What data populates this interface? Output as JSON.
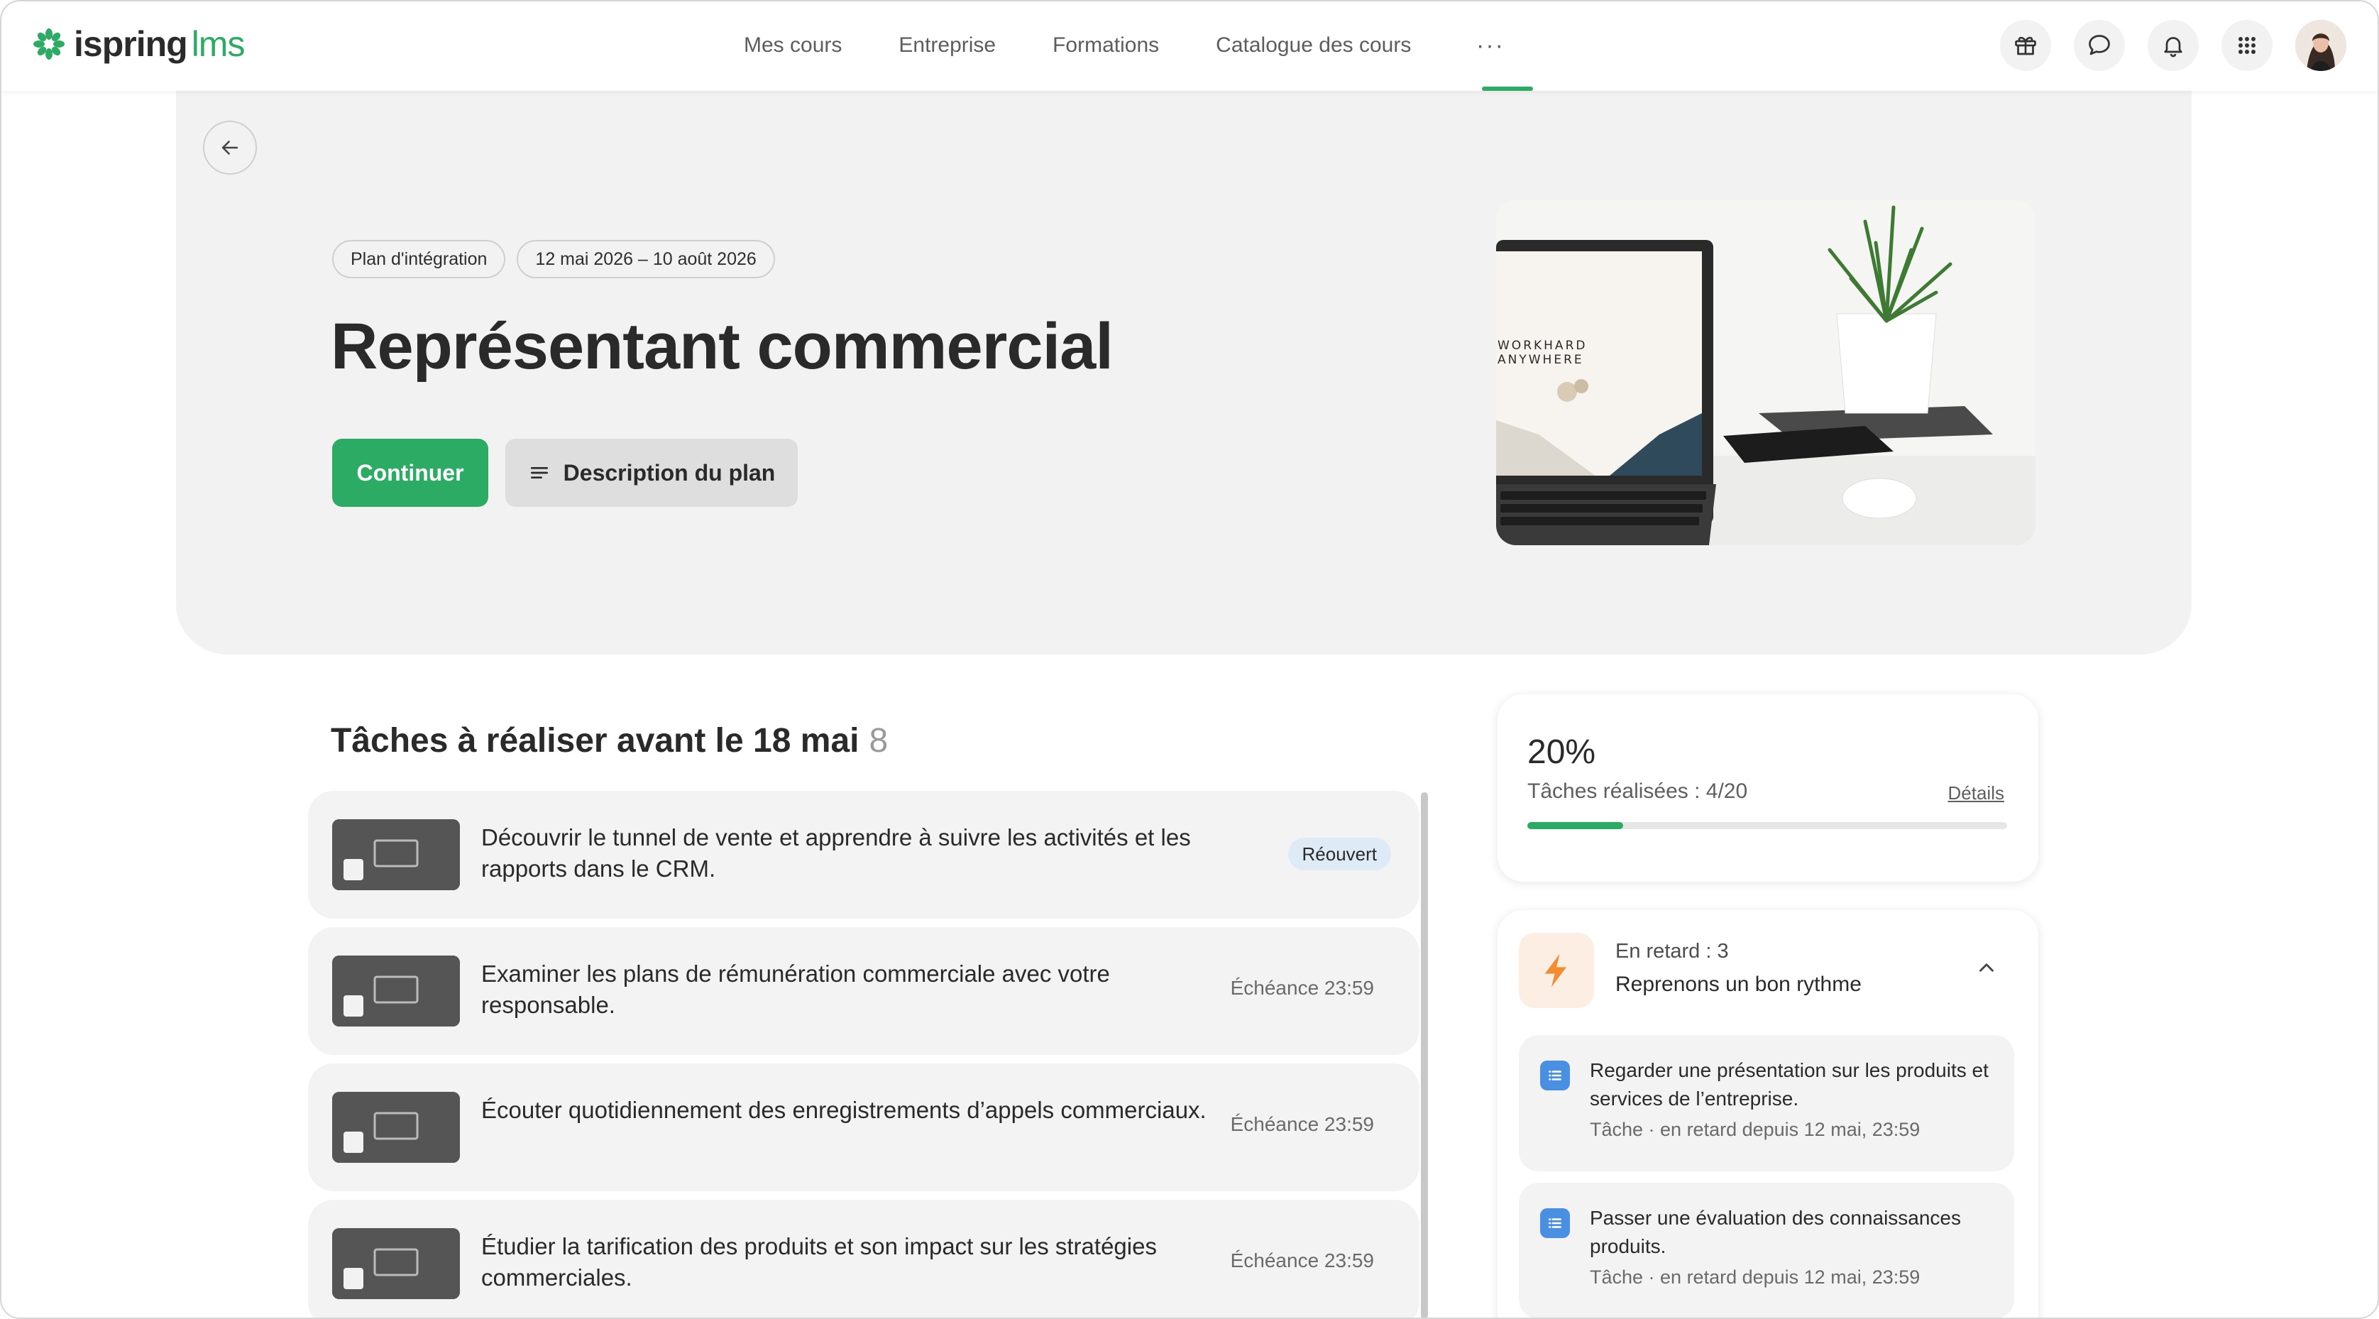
{
  "brand": {
    "name": "ispring",
    "suffix": "lms",
    "accent": "#2bab63"
  },
  "nav": {
    "items": [
      "Mes cours",
      "Entreprise",
      "Formations",
      "Catalogue des cours"
    ],
    "more": "···"
  },
  "header_icons": [
    "gift-icon",
    "chat-icon",
    "bell-icon",
    "apps-grid-icon",
    "user-avatar"
  ],
  "hero": {
    "chips": [
      "Plan d'intégration",
      "12 mai 2026 – 10 août 2026"
    ],
    "title": "Représentant commercial",
    "continue_label": "Continuer",
    "description_label": "Description du plan",
    "image_text": "WORKHARD\nANYWHERE"
  },
  "tasks": {
    "heading": "Tâches à réaliser avant le 18 mai",
    "count": "8",
    "items": [
      {
        "text": "Découvrir le tunnel de vente et apprendre à suivre les activités et les rapports dans le CRM.",
        "badge": "Réouvert"
      },
      {
        "text": "Examiner les plans de rémunération commerciale avec votre responsable.",
        "meta": "Échéance 23:59"
      },
      {
        "text": "Écouter quotidiennement des enregistrements d’appels commerciaux.",
        "meta": "Échéance 23:59"
      },
      {
        "text": "Étudier la tarification des produits et son impact sur les stratégies commerciales.",
        "meta": "Échéance 23:59"
      }
    ]
  },
  "progress": {
    "percent_label": "20%",
    "fraction": 0.2,
    "label": "Tâches réalisées : 4/20",
    "details": "Détails"
  },
  "late": {
    "count_label": "En retard : 3",
    "subtitle": "Reprenons un bon rythme",
    "items": [
      {
        "title": "Regarder une présentation sur les produits et services de l’entreprise.",
        "meta": "Tâche · en retard depuis 12 mai, 23:59"
      },
      {
        "title": "Passer une évaluation des connaissances produits.",
        "meta": "Tâche · en retard depuis 12 mai, 23:59"
      }
    ]
  }
}
